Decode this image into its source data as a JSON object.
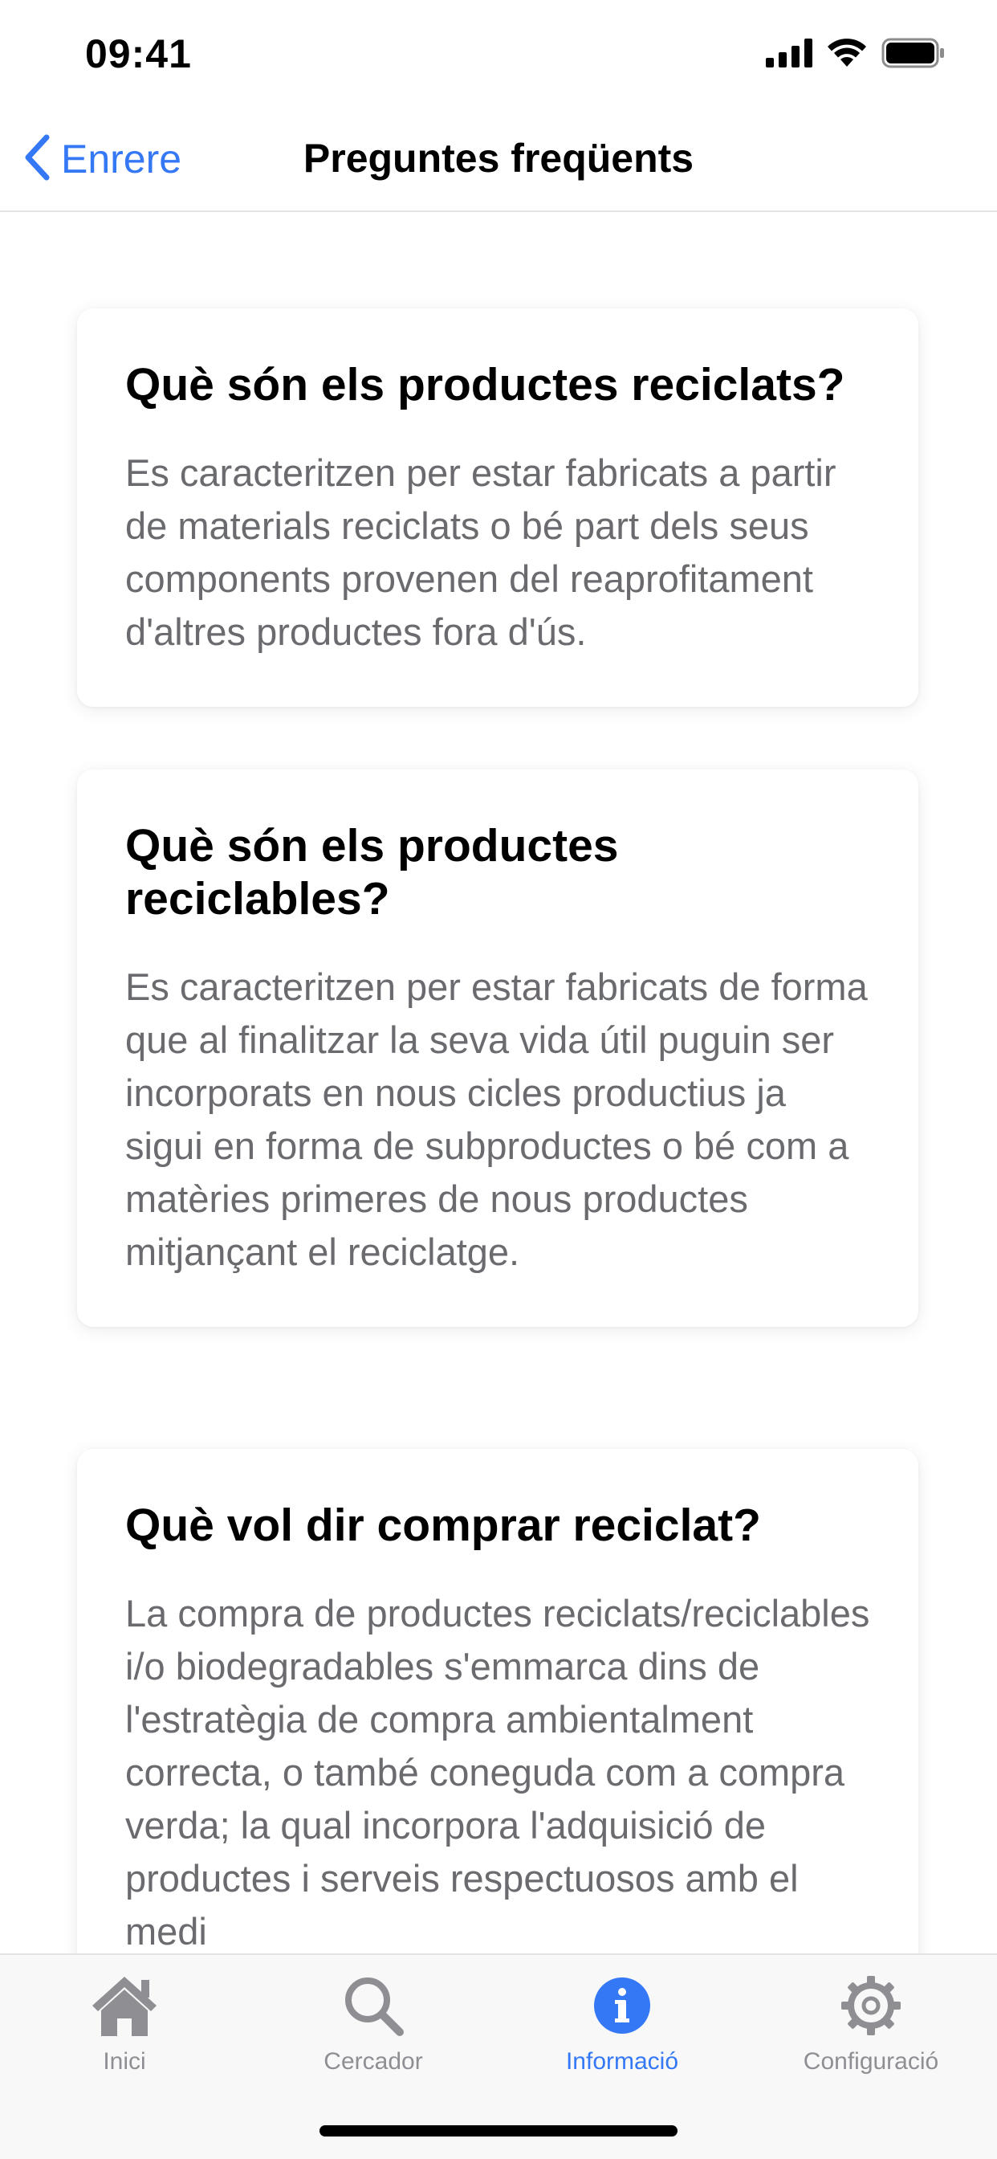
{
  "status_bar": {
    "time": "09:41",
    "icons": [
      "cellular-signal-icon",
      "wifi-icon",
      "battery-icon"
    ]
  },
  "nav": {
    "back_label": "Enrere",
    "title": "Preguntes freqüents"
  },
  "faqs": [
    {
      "question": "Què són els productes reciclats?",
      "answer": "Es caracteritzen per estar fabricats a partir de materials reciclats o bé part dels seus components provenen del reaprofitament d'altres productes fora d'ús."
    },
    {
      "question": "Què són els productes reciclables?",
      "answer": "Es caracteritzen per estar fabricats de forma que al finalitzar la seva vida útil puguin ser incorporats en nous cicles productius ja sigui en forma de subproductes o bé com a matèries primeres de nous productes mitjançant el reciclatge."
    },
    {
      "question": "Què vol dir comprar reciclat?",
      "answer": "La compra de productes reciclats/reciclables i/o biodegradables s'emmarca dins de l'estratègia de compra ambientalment correcta, o també coneguda com a compra verda; la qual incorpora l'adquisició de productes i serveis respectuosos amb el medi"
    }
  ],
  "tabs": [
    {
      "label": "Inici",
      "icon": "home-icon",
      "active": false
    },
    {
      "label": "Cercador",
      "icon": "search-icon",
      "active": false
    },
    {
      "label": "Informació",
      "icon": "info-icon",
      "active": true
    },
    {
      "label": "Configuració",
      "icon": "gear-icon",
      "active": false
    }
  ],
  "colors": {
    "accent": "#3478f6",
    "inactive": "#8e8e93",
    "body_text": "#6b6b6f"
  }
}
